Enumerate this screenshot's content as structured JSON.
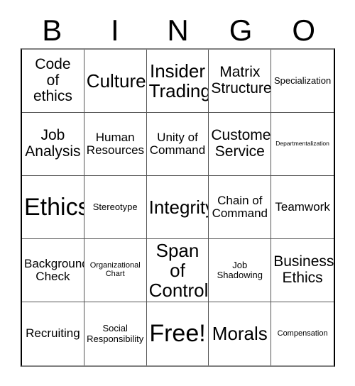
{
  "header": {
    "letters": [
      "B",
      "I",
      "N",
      "G",
      "O"
    ]
  },
  "grid": {
    "rows": 5,
    "columns": 5,
    "border_color": "#555555",
    "outer_border_color": "#000000",
    "background": "#ffffff",
    "text_color": "#000000",
    "cells": [
      {
        "text": "Code\nof\nethics",
        "size": "lg"
      },
      {
        "text": "Culture",
        "size": "xl"
      },
      {
        "text": "Insider\nTrading",
        "size": "xl"
      },
      {
        "text": "Matrix\nStructure",
        "size": "lg"
      },
      {
        "text": "Specialization",
        "size": "sm"
      },
      {
        "text": "Job\nAnalysis",
        "size": "lg"
      },
      {
        "text": "Human\nResources",
        "size": "md"
      },
      {
        "text": "Unity of\nCommand",
        "size": "md"
      },
      {
        "text": "Customer\nService",
        "size": "lg"
      },
      {
        "text": "Departmentalization",
        "size": "xxs"
      },
      {
        "text": "Ethics",
        "size": "xxl"
      },
      {
        "text": "Stereotype",
        "size": "sm"
      },
      {
        "text": "Integrity",
        "size": "xl"
      },
      {
        "text": "Chain of\nCommand",
        "size": "md"
      },
      {
        "text": "Teamwork",
        "size": "md"
      },
      {
        "text": "Background\nCheck",
        "size": "md"
      },
      {
        "text": "Organizational\nChart",
        "size": "xs"
      },
      {
        "text": "Span\nof\nControl",
        "size": "xl"
      },
      {
        "text": "Job\nShadowing",
        "size": "sm"
      },
      {
        "text": "Business\nEthics",
        "size": "lg"
      },
      {
        "text": "Recruiting",
        "size": "md"
      },
      {
        "text": "Social\nResponsibility",
        "size": "sm"
      },
      {
        "text": "Free!",
        "size": "xxl"
      },
      {
        "text": "Morals",
        "size": "xl"
      },
      {
        "text": "Compensation",
        "size": "xs"
      }
    ]
  }
}
